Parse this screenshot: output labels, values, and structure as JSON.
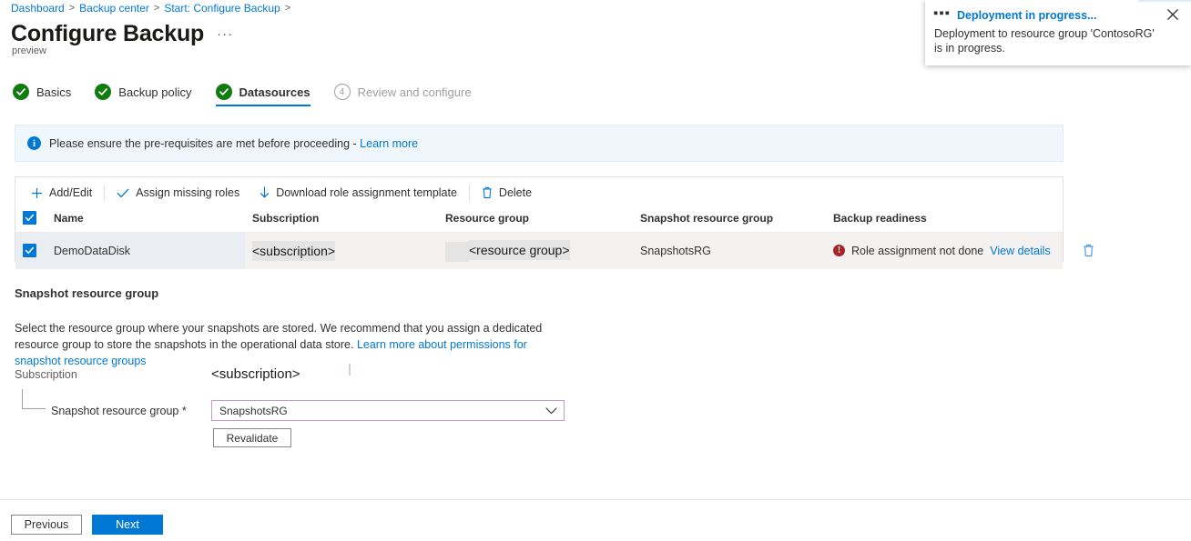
{
  "breadcrumb": {
    "items": [
      {
        "label": "Dashboard"
      },
      {
        "label": "Backup center"
      },
      {
        "label": "Start: Configure Backup"
      }
    ],
    "separator": ">"
  },
  "header": {
    "title": "Configure Backup",
    "ellipsis": "···",
    "preview_tag": "preview"
  },
  "toast": {
    "dots": "▪▪▪",
    "title": "Deployment in progress...",
    "body": "Deployment to resource group 'ContosoRG' is in progress.",
    "close_label": "Close"
  },
  "wizard": {
    "steps": [
      {
        "label": "Basics",
        "state": "done",
        "number": "1"
      },
      {
        "label": "Backup policy",
        "state": "done",
        "number": "2"
      },
      {
        "label": "Datasources",
        "state": "current",
        "number": "3"
      },
      {
        "label": "Review and configure",
        "state": "pending",
        "number": "4"
      }
    ]
  },
  "info_banner": {
    "icon_glyph": "i",
    "text": "Please ensure the pre-requisites are met before proceeding - ",
    "link_label": "Learn more"
  },
  "toolbar": {
    "add_edit_label": "Add/Edit",
    "assign_roles_label": "Assign missing roles",
    "download_template_label": "Download role assignment template",
    "delete_label": "Delete"
  },
  "table": {
    "columns": [
      "Name",
      "Subscription",
      "Resource group",
      "Snapshot resource group",
      "Backup readiness"
    ],
    "rows": [
      {
        "checked": true,
        "name": "DemoDataDisk",
        "subscription": "<subscription>",
        "resource_group": "<resource group>",
        "snapshot_resource_group": "SnapshotsRG",
        "readiness": "Role assignment not done",
        "readiness_state": "error",
        "view_details_label": "View details"
      }
    ],
    "select_all_checked": true
  },
  "snapshot_section": {
    "title": "Snapshot resource group",
    "description": "Select the resource group where your snapshots are stored. We recommend that you assign a dedicated resource group to store the snapshots in the operational data store. ",
    "description_link": "Learn more about permissions for snapshot resource groups",
    "subscription_label": "Subscription",
    "subscription_value": "<subscription>",
    "resource_group_label": "Snapshot resource group *",
    "resource_group_value": "SnapshotsRG",
    "revalidate_label": "Revalidate"
  },
  "footer": {
    "previous_label": "Previous",
    "next_label": "Next"
  },
  "colors": {
    "accent": "#0078d4",
    "success": "#107c10",
    "error": "#a4262c",
    "field_modified_border": "#c499c4",
    "info_bg": "#eff6fc",
    "row_bg": "#f3f2f1"
  }
}
